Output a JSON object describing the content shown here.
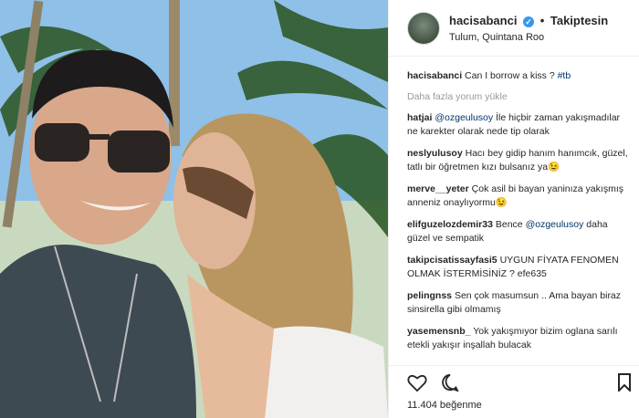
{
  "post": {
    "username": "hacisabanci",
    "verified_icon": "verified-badge-icon",
    "separator": "•",
    "follow_label": "Takiptesin",
    "location": "Tulum, Quintana Roo",
    "caption_user": "hacisabanci",
    "caption_text": "Can I borrow a kiss ?",
    "caption_tag": "#tb",
    "load_more": "Daha fazla yorum yükle",
    "likes": "11.404 beğenme"
  },
  "comments": [
    {
      "user": "hatjai",
      "mention": "@ozgeulusoy",
      "text": "İle hiçbir zaman yakışmadılar ne karekter olarak nede tip olarak"
    },
    {
      "user": "neslyulusoy",
      "mention": "",
      "text": "Hacı bey gidip hanım hanımcık, güzel, tatlı bir öğretmen kızı bulsanız ya😉"
    },
    {
      "user": "merve__yeter",
      "mention": "",
      "text": "Çok asil bi bayan yaninıza yakışmış anneniz onaylıyormu😉"
    },
    {
      "user": "elifguzelozdemir33",
      "mention": "@ozgeulusoy",
      "pre": "Bence",
      "text": "daha güzel ve sempatik"
    },
    {
      "user": "takipcisatissayfasi5",
      "mention": "",
      "text": "UYGUN FİYATA FENOMEN OLMAK İSTERMİSİNİZ ? efe635"
    },
    {
      "user": "pelingnss",
      "mention": "",
      "text": "Sen çok masumsun .. Ama bayan biraz sinsirella gibi olmamış"
    },
    {
      "user": "yasemensnb_",
      "mention": "",
      "text": "Yok yakışmıyor bizim oglana sarılı etekli yakışır inşallah bulacak"
    }
  ],
  "icons": {
    "like": "heart-icon",
    "comment": "comment-icon",
    "save": "bookmark-icon"
  },
  "colors": {
    "link": "#003569",
    "verified": "#3897f0",
    "muted": "#999999"
  }
}
